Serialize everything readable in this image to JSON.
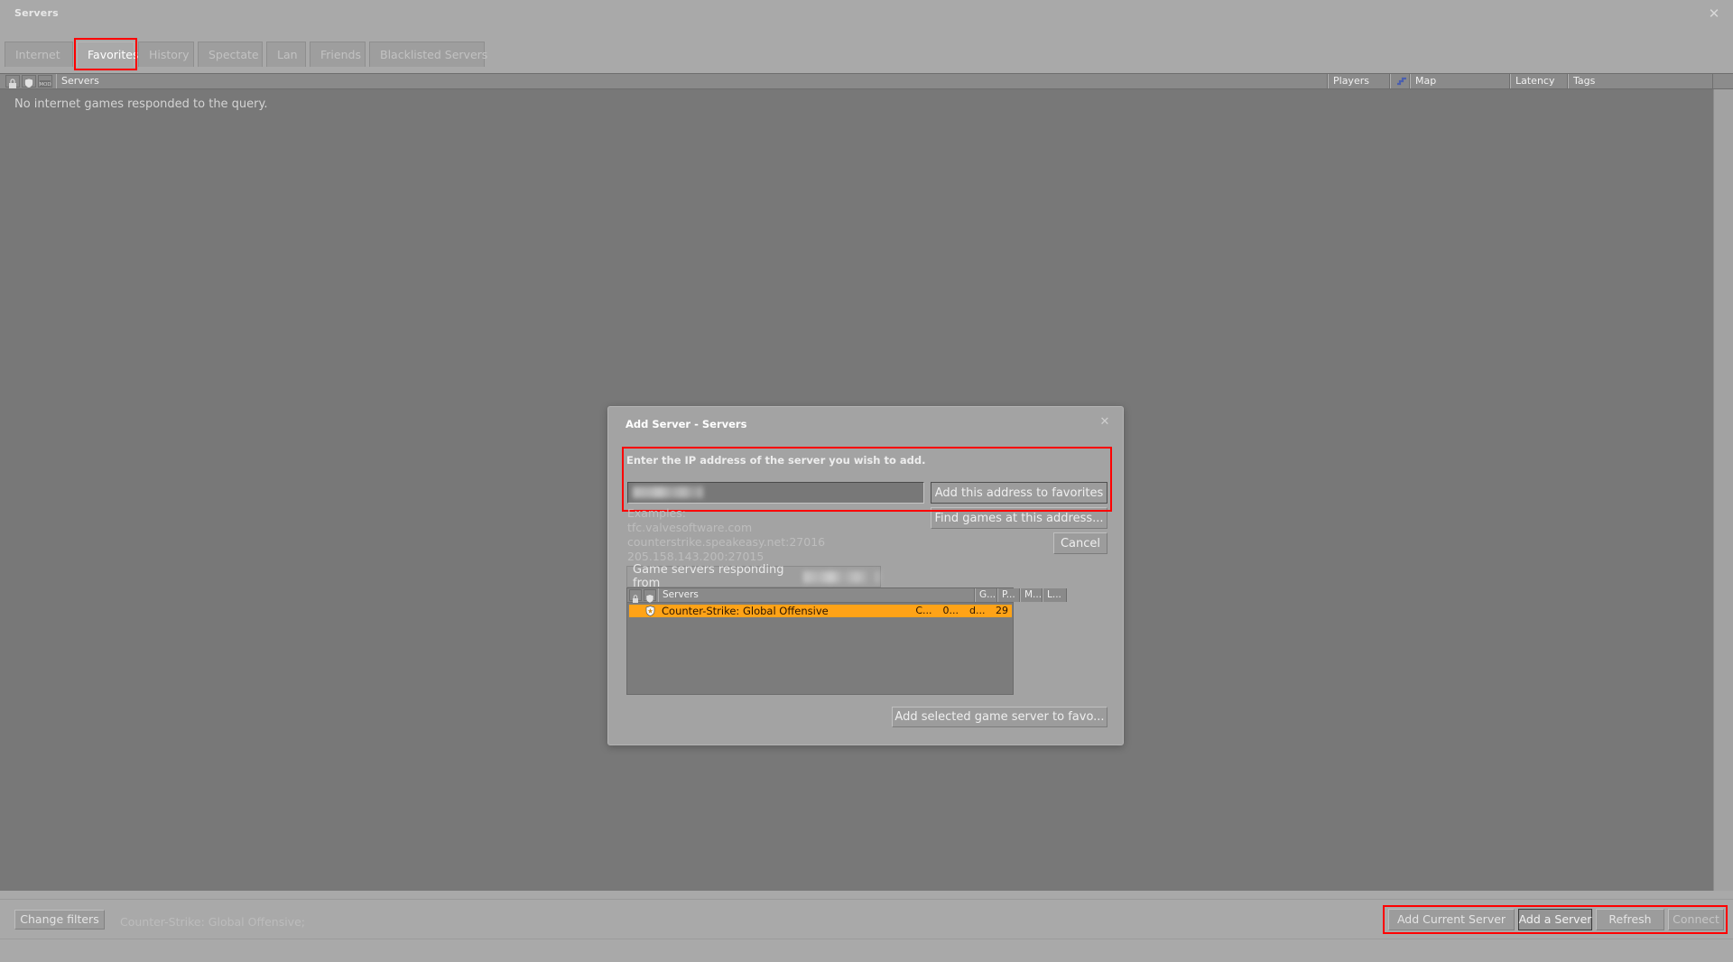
{
  "window": {
    "title": "Servers",
    "close_icon": "close-icon",
    "close_glyph": "✕"
  },
  "tabs": [
    {
      "label": "Internet",
      "active": false
    },
    {
      "label": "Favorites",
      "active": true,
      "highlighted": true
    },
    {
      "label": "History",
      "active": false
    },
    {
      "label": "Spectate",
      "active": false
    },
    {
      "label": "Lan",
      "active": false
    },
    {
      "label": "Friends",
      "active": false
    },
    {
      "label": "Blacklisted Servers",
      "active": false
    }
  ],
  "main_list": {
    "icon_columns": [
      "lock-icon",
      "shield-icon",
      "mod-icon"
    ],
    "columns": [
      "Servers",
      "Players",
      "Map",
      "Latency",
      "Tags"
    ],
    "map_sort_icon": "sort-icon",
    "empty_message": "No internet games responded to the query.",
    "rows": []
  },
  "bottom_bar": {
    "change_filters_label": "Change filters",
    "filter_description": "Counter-Strike: Global Offensive;",
    "buttons": [
      {
        "label": "Add Current Server",
        "style": "normal"
      },
      {
        "label": "Add a Server",
        "style": "dark"
      },
      {
        "label": "Refresh",
        "style": "normal"
      },
      {
        "label": "Connect",
        "style": "dim"
      }
    ],
    "highlighted": true
  },
  "dialog": {
    "title": "Add Server - Servers",
    "close_glyph": "✕",
    "prompt": "Enter the IP address of the server you wish to add.",
    "ip_input": {
      "value": "",
      "redacted": true,
      "placeholder": ""
    },
    "buttons": {
      "add_address": "Add this address to favorites",
      "find_games": "Find games at this address...",
      "cancel": "Cancel",
      "add_selected": "Add selected game server to favo..."
    },
    "examples_label": "Examples:",
    "examples": [
      "tfc.valvesoftware.com",
      "counterstrike.speakeasy.net:27016",
      "205.158.143.200:27015"
    ],
    "responding_label": "Game servers responding from",
    "responding_value_redacted": true,
    "list": {
      "icon_columns": [
        "lock-icon",
        "shield-icon"
      ],
      "columns": [
        "Servers",
        "G...",
        "P...",
        "M...",
        "L..."
      ],
      "rows": [
        {
          "icon": "shield-icon",
          "name": "Counter-Strike: Global Offensive",
          "game": "C...",
          "players": "0...",
          "map": "d...",
          "latency": "29",
          "selected": true
        }
      ]
    }
  },
  "colors": {
    "background": "#a9a9a9",
    "list_background": "#787878",
    "header": "#8a8a8a",
    "selection": "#ffa317",
    "highlight": "#ff0000",
    "text": "#e8e8e8"
  }
}
